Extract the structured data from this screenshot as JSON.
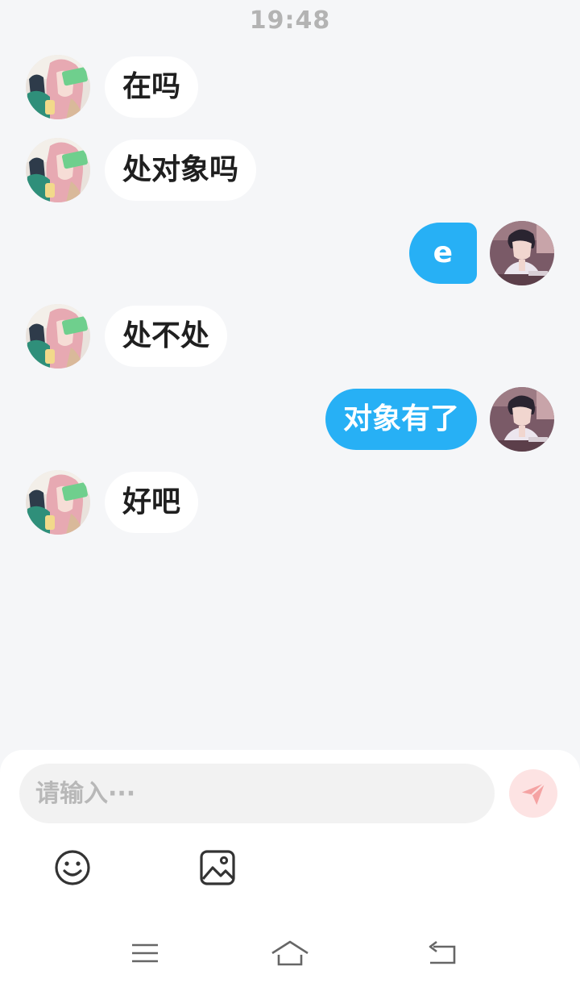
{
  "status": {
    "time": "19:48"
  },
  "messages": [
    {
      "side": "left",
      "text": "在吗"
    },
    {
      "side": "left",
      "text": "处对象吗"
    },
    {
      "side": "right",
      "text": "e"
    },
    {
      "side": "left",
      "text": "处不处"
    },
    {
      "side": "right",
      "text": "对象有了"
    },
    {
      "side": "left",
      "text": "好吧"
    }
  ],
  "composer": {
    "placeholder": "请输入···",
    "send_icon": "paper-plane-icon",
    "emoji_icon": "smiley-icon",
    "image_icon": "image-icon"
  },
  "colors": {
    "outgoing_bubble": "#27b0f5",
    "incoming_bubble": "#ffffff",
    "send_button_bg": "#fde3e3",
    "send_icon": "#f5a3a3"
  },
  "nav": {
    "menu_icon": "menu-icon",
    "home_icon": "home-icon",
    "back_icon": "back-icon"
  }
}
